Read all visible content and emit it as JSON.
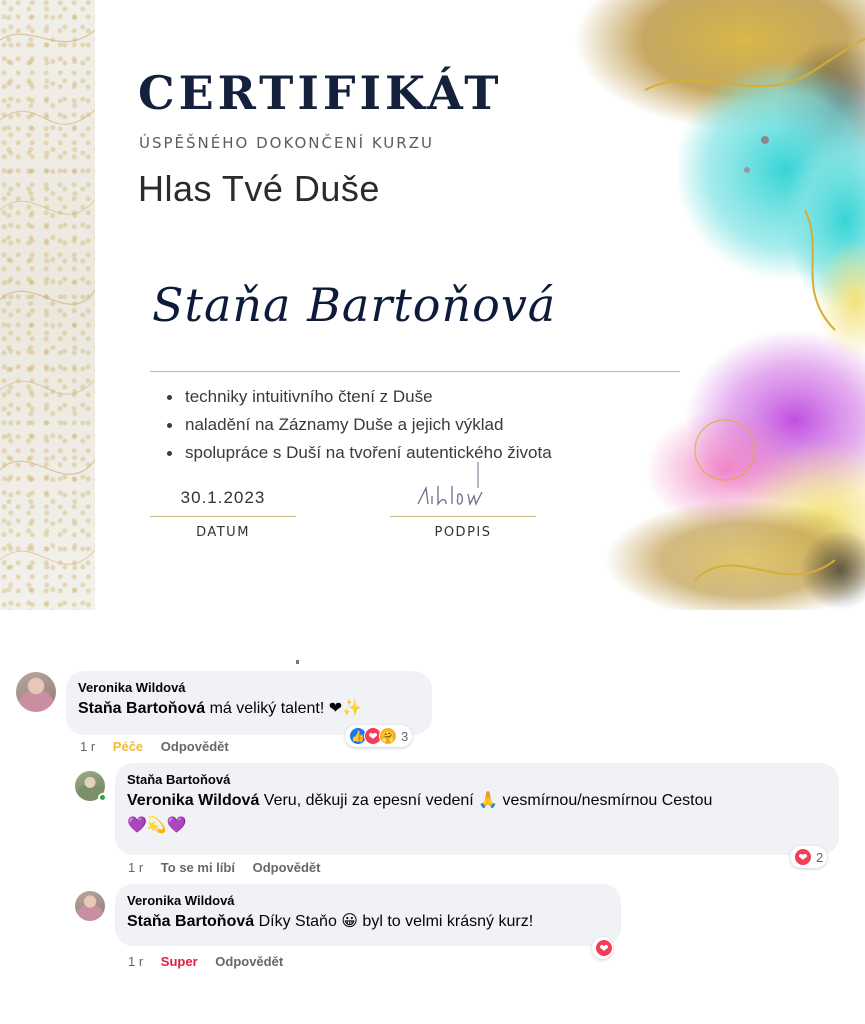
{
  "certificate": {
    "title": "CERTIFIKÁT",
    "subtitle": "ÚSPĚŠNÉHO DOKONČENÍ KURZU",
    "course_name": "Hlas Tvé Duše",
    "recipient": "Staňa Bartoňová",
    "skills": [
      "techniky intuitivního čtení z Duše",
      "naladění na Záznamy Duše a jejich výklad",
      "spolupráce s Duší na tvoření autentického života"
    ],
    "date_value": "30.1.2023",
    "date_label": "DATUM",
    "signature_label": "PODPIS",
    "accent_colors": {
      "navy": "#14213d",
      "gold": "#c9a94a",
      "teal": "#3fd0d0",
      "violet": "#b25bd6",
      "pink": "#e46fb8"
    }
  },
  "comments": [
    {
      "author": "Veronika Wildová",
      "mention": "Staňa Bartoňová",
      "text": " má veliký talent! ",
      "emojis": "❤✨",
      "time": "1 r",
      "reaction_label": "Péče",
      "reply_label": "Odpovědět",
      "reaction_count": "3",
      "reaction_icons": [
        "like-icon",
        "love-icon",
        "care-icon"
      ]
    },
    {
      "author": "Staňa Bartoňová",
      "mention": "Veronika Wildová",
      "text_before_emoji": " Veru, děkuji za epesní vedení ",
      "pray_emoji": "🙏",
      "text_after_emoji": " vesmírnou/nesmírnou Cestou",
      "line2_emojis": "💜💫💜",
      "time": "1 r",
      "reaction_label": "To se mi líbí",
      "reply_label": "Odpovědět",
      "reaction_count": "2",
      "reaction_icons": [
        "love-icon"
      ]
    },
    {
      "author": "Veronika Wildová",
      "mention": "Staňa Bartoňová",
      "text_before_emoji": " Díky Staňo ",
      "smile_emoji": "😀",
      "text_after_emoji": " byl to velmi krásný kurz!",
      "time": "1 r",
      "reaction_label": "Super",
      "reply_label": "Odpovědět",
      "reaction_icons": [
        "love-icon"
      ]
    }
  ]
}
